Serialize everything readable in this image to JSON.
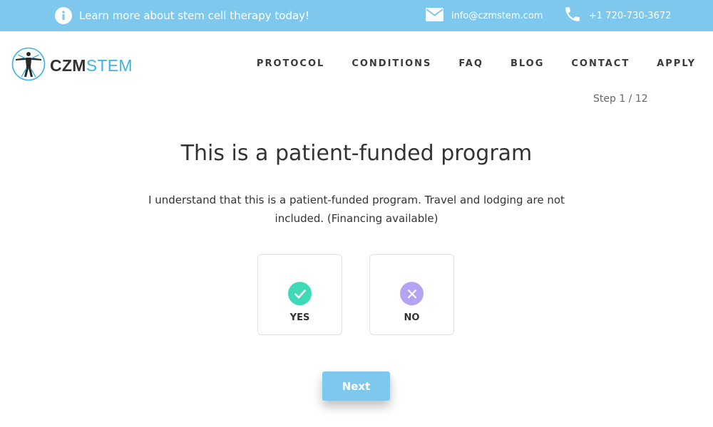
{
  "topbar": {
    "info_text": "Learn more about stem cell therapy today!",
    "email": "info@czmstem.com",
    "phone": "+1 720-730-3672",
    "icons": {
      "info": "info-circle-icon",
      "email": "envelope-icon",
      "phone": "phone-icon"
    }
  },
  "logo": {
    "part1": "CZM",
    "part2": "STEM"
  },
  "nav": {
    "items": [
      {
        "label": "PROTOCOL"
      },
      {
        "label": "CONDITIONS"
      },
      {
        "label": "FAQ"
      },
      {
        "label": "BLOG"
      },
      {
        "label": "CONTACT"
      },
      {
        "label": "APPLY"
      }
    ]
  },
  "step": "Step 1 / 12",
  "question": {
    "title": "This is a patient-funded program",
    "description": "I understand that this is a patient-funded program. Travel and lodging are not included. (Financing available)"
  },
  "options": [
    {
      "label": "YES",
      "icon": "check-icon"
    },
    {
      "label": "NO",
      "icon": "x-icon"
    }
  ],
  "next_button": "Next",
  "colors": {
    "brand_blue": "#7ec8ee",
    "logo_blue": "#3fb3e4",
    "yes_green": "#3ed9b6",
    "no_purple": "#b6a2f2",
    "text": "#333333"
  }
}
